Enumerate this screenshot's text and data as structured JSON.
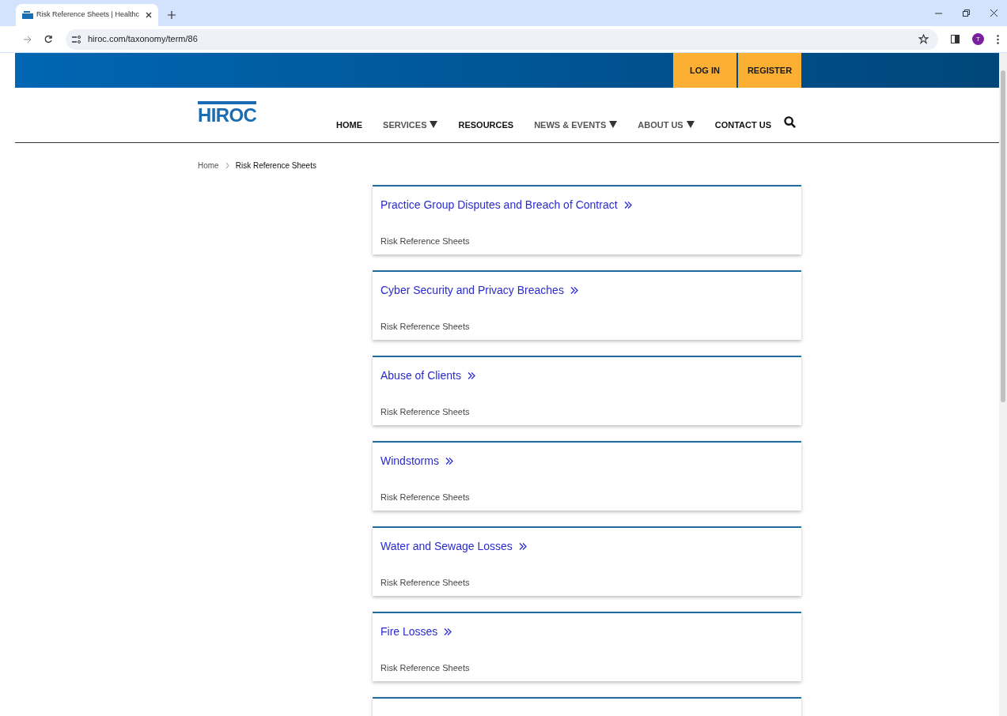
{
  "browser": {
    "tab_title": "Risk Reference Sheets | Healthc",
    "url": "hiroc.com/taxonomy/term/86",
    "profile_initial": "T"
  },
  "top_bar": {
    "buttons": [
      "LOG IN",
      "REGISTER"
    ]
  },
  "header": {
    "logo": "HIROC",
    "nav": [
      {
        "label": "HOME",
        "dropdown": false
      },
      {
        "label": "SERVICES",
        "dropdown": true
      },
      {
        "label": "RESOURCES",
        "dropdown": false
      },
      {
        "label": "NEWS & EVENTS",
        "dropdown": true
      },
      {
        "label": "ABOUT US",
        "dropdown": true
      },
      {
        "label": "CONTACT US",
        "dropdown": false
      }
    ]
  },
  "breadcrumb": [
    "Home",
    "Risk Reference Sheets"
  ],
  "cards": [
    {
      "title": "Practice Group Disputes and Breach of Contract",
      "category": "Risk Reference Sheets"
    },
    {
      "title": "Cyber Security and Privacy Breaches",
      "category": "Risk Reference Sheets"
    },
    {
      "title": "Abuse of Clients",
      "category": "Risk Reference Sheets"
    },
    {
      "title": "Windstorms",
      "category": "Risk Reference Sheets"
    },
    {
      "title": "Water and Sewage Losses",
      "category": "Risk Reference Sheets"
    },
    {
      "title": "Fire Losses",
      "category": "Risk Reference Sheets"
    }
  ]
}
